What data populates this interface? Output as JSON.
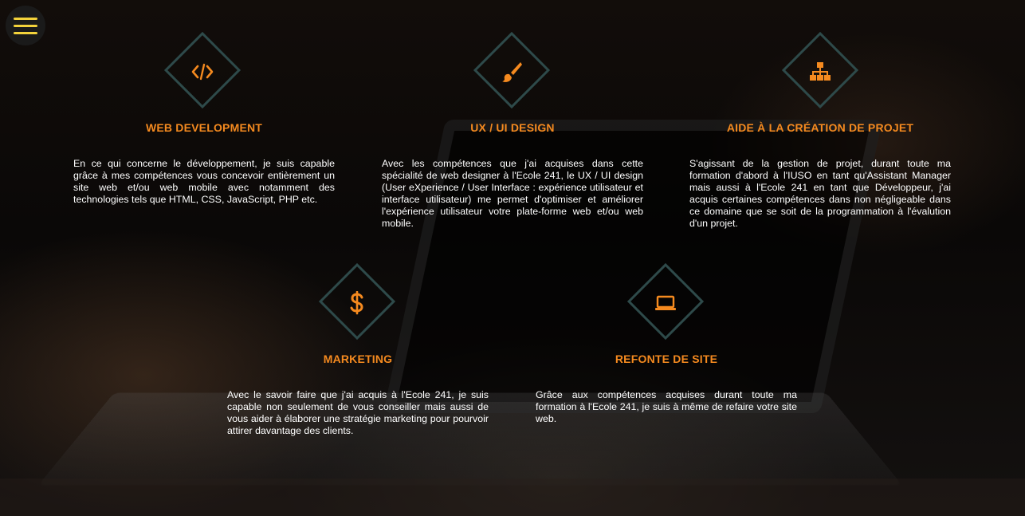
{
  "menu": {
    "icon": "hamburger-icon"
  },
  "services": [
    {
      "icon": "code-icon",
      "title": "WEB DEVELOPMENT",
      "text": "En ce qui concerne le développement, je suis capable grâce à mes compétences vous concevoir entièrement un site web et/ou web mobile avec notamment des technologies tels que HTML, CSS, JavaScript, PHP etc."
    },
    {
      "icon": "paintbrush-icon",
      "title": "UX / UI DESIGN",
      "text": "Avec les compétences que j'ai acquises dans cette spécialité de web designer à l'Ecole 241, le UX / UI design (User eXperience / User Interface : expérience utilisateur et interface utilisateur) me permet d'optimiser et améliorer l'expérience utilisateur votre plate-forme web et/ou web mobile."
    },
    {
      "icon": "sitemap-icon",
      "title": "AIDE À LA CRÉATION DE PROJET",
      "text": "S'agissant de la gestion de projet, durant toute ma formation d'abord à l'IUSO en tant qu'Assistant Manager mais aussi à l'Ecole 241 en tant que Développeur, j'ai acquis certaines compétences dans non négligeable dans ce domaine que se soit de la programmation à l'évalution d'un projet."
    },
    {
      "icon": "dollar-icon",
      "title": "MARKETING",
      "text": "Avec le savoir faire que j'ai acquis à l'Ecole 241, je suis capable non seulement de vous conseiller mais aussi de vous aider à élaborer une stratégie marketing pour pourvoir attirer davantage des clients."
    },
    {
      "icon": "laptop-icon",
      "title": "REFONTE DE SITE",
      "text": "Grâce aux compétences acquises durant toute ma formation à l'Ecole 241, je suis à même de refaire votre site web."
    }
  ],
  "colors": {
    "accent": "#f58a1f",
    "menu_lines": "#f3d23b",
    "diamond_border": "#2e4a4a",
    "text": "#ffffff"
  }
}
